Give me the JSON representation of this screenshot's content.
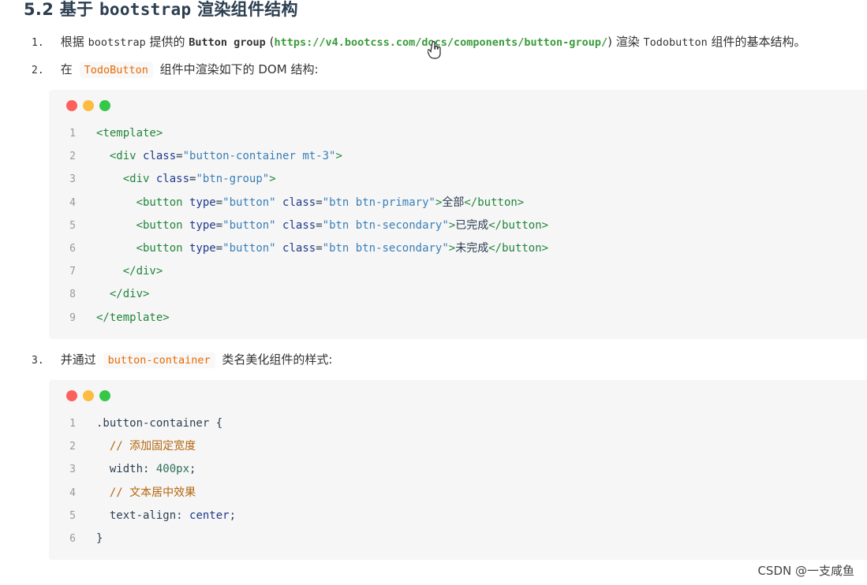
{
  "heading": {
    "prefix": "5.2 基于 ",
    "mono": "bootstrap",
    "suffix": " 渲染组件结构"
  },
  "steps": [
    {
      "num": "1.",
      "parts": [
        "根据 ",
        "bootstrap",
        " 提供的 ",
        "Button group",
        " (",
        "https://v4.bootcss.com/docs/components/button-group/",
        ") 渲染 ",
        "Todobutton",
        " 组件的基本结构。"
      ]
    },
    {
      "num": "2.",
      "before": "在 ",
      "code": "TodoButton",
      "after": " 组件中渲染如下的 DOM 结构:"
    },
    {
      "num": "3.",
      "before": "并通过 ",
      "code": "button-container",
      "after": " 类名美化组件的样式:"
    }
  ],
  "code_block_1": {
    "line_numbers": [
      "1",
      "2",
      "3",
      "4",
      "5",
      "6",
      "7",
      "8",
      "9"
    ],
    "lines": [
      [
        {
          "t": "tag",
          "v": "<template>"
        }
      ],
      [
        {
          "t": "sp",
          "v": "  "
        },
        {
          "t": "tag",
          "v": "<div "
        },
        {
          "t": "attr",
          "v": "class"
        },
        {
          "t": "plain",
          "v": "="
        },
        {
          "t": "str",
          "v": "\"button-container mt-3\""
        },
        {
          "t": "tag",
          "v": ">"
        }
      ],
      [
        {
          "t": "sp",
          "v": "    "
        },
        {
          "t": "tag",
          "v": "<div "
        },
        {
          "t": "attr",
          "v": "class"
        },
        {
          "t": "plain",
          "v": "="
        },
        {
          "t": "str",
          "v": "\"btn-group\""
        },
        {
          "t": "tag",
          "v": ">"
        }
      ],
      [
        {
          "t": "sp",
          "v": "      "
        },
        {
          "t": "tag",
          "v": "<button "
        },
        {
          "t": "attr",
          "v": "type"
        },
        {
          "t": "plain",
          "v": "="
        },
        {
          "t": "str",
          "v": "\"button\""
        },
        {
          "t": "plain",
          "v": " "
        },
        {
          "t": "attr",
          "v": "class"
        },
        {
          "t": "plain",
          "v": "="
        },
        {
          "t": "str",
          "v": "\"btn btn-primary\""
        },
        {
          "t": "tag",
          "v": ">"
        },
        {
          "t": "plain",
          "v": "全部"
        },
        {
          "t": "tag",
          "v": "</button>"
        }
      ],
      [
        {
          "t": "sp",
          "v": "      "
        },
        {
          "t": "tag",
          "v": "<button "
        },
        {
          "t": "attr",
          "v": "type"
        },
        {
          "t": "plain",
          "v": "="
        },
        {
          "t": "str",
          "v": "\"button\""
        },
        {
          "t": "plain",
          "v": " "
        },
        {
          "t": "attr",
          "v": "class"
        },
        {
          "t": "plain",
          "v": "="
        },
        {
          "t": "str",
          "v": "\"btn btn-secondary\""
        },
        {
          "t": "tag",
          "v": ">"
        },
        {
          "t": "plain",
          "v": "已完成"
        },
        {
          "t": "tag",
          "v": "</button>"
        }
      ],
      [
        {
          "t": "sp",
          "v": "      "
        },
        {
          "t": "tag",
          "v": "<button "
        },
        {
          "t": "attr",
          "v": "type"
        },
        {
          "t": "plain",
          "v": "="
        },
        {
          "t": "str",
          "v": "\"button\""
        },
        {
          "t": "plain",
          "v": " "
        },
        {
          "t": "attr",
          "v": "class"
        },
        {
          "t": "plain",
          "v": "="
        },
        {
          "t": "str",
          "v": "\"btn btn-secondary\""
        },
        {
          "t": "tag",
          "v": ">"
        },
        {
          "t": "plain",
          "v": "未完成"
        },
        {
          "t": "tag",
          "v": "</button>"
        }
      ],
      [
        {
          "t": "sp",
          "v": "    "
        },
        {
          "t": "tag",
          "v": "</div>"
        }
      ],
      [
        {
          "t": "sp",
          "v": "  "
        },
        {
          "t": "tag",
          "v": "</div>"
        }
      ],
      [
        {
          "t": "tag",
          "v": "</template>"
        }
      ]
    ]
  },
  "code_block_2": {
    "line_numbers": [
      "1",
      "2",
      "3",
      "4",
      "5",
      "6"
    ],
    "lines": [
      [
        {
          "t": "plain",
          "v": ".button-container {"
        }
      ],
      [
        {
          "t": "sp",
          "v": "  "
        },
        {
          "t": "cmt",
          "v": "// 添加固定宽度"
        }
      ],
      [
        {
          "t": "sp",
          "v": "  "
        },
        {
          "t": "plain",
          "v": "width: "
        },
        {
          "t": "num-v",
          "v": "400px"
        },
        {
          "t": "plain",
          "v": ";"
        }
      ],
      [
        {
          "t": "sp",
          "v": "  "
        },
        {
          "t": "cmt",
          "v": "// 文本居中效果"
        }
      ],
      [
        {
          "t": "sp",
          "v": "  "
        },
        {
          "t": "plain",
          "v": "text-align: "
        },
        {
          "t": "kw",
          "v": "center"
        },
        {
          "t": "plain",
          "v": ";"
        }
      ],
      [
        {
          "t": "plain",
          "v": "}"
        }
      ]
    ]
  },
  "watermark": "CSDN @一支咸鱼",
  "colors": {
    "dot_red": "#fc605c",
    "dot_yellow": "#fdbc40",
    "dot_green": "#34c748",
    "link": "#3a9b3a",
    "inline_code": "#e96900"
  },
  "icons": {
    "cursor": "hand-pointer-icon"
  }
}
